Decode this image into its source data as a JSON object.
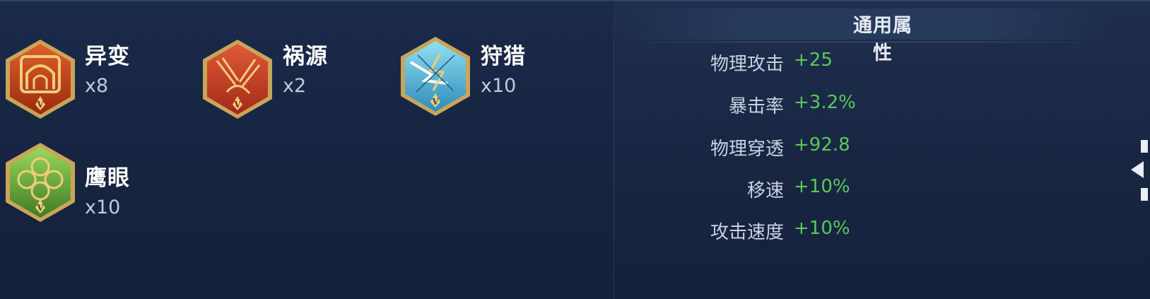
{
  "emblems": [
    {
      "name": "异变",
      "count": "x8",
      "tier": "V",
      "color": "#c8461c",
      "icon": "mutation-emblem-icon"
    },
    {
      "name": "祸源",
      "count": "x2",
      "tier": "V",
      "color": "#d0462a",
      "icon": "calamity-emblem-icon"
    },
    {
      "name": "狩猎",
      "count": "x10",
      "tier": "V",
      "color": "#4fb8d8",
      "icon": "hunt-emblem-icon"
    },
    {
      "name": "鹰眼",
      "count": "x10",
      "tier": "V",
      "color": "#6fae3a",
      "icon": "hawkeye-emblem-icon"
    }
  ],
  "attributes": {
    "title": "通用属性",
    "rows": [
      {
        "label": "物理攻击",
        "value": "+25"
      },
      {
        "label": "暴击率",
        "value": "+3.2%"
      },
      {
        "label": "物理穿透",
        "value": "+92.8"
      },
      {
        "label": "移速",
        "value": "+10%"
      },
      {
        "label": "攻击速度",
        "value": "+10%"
      }
    ],
    "value_color": "#58c85a"
  }
}
